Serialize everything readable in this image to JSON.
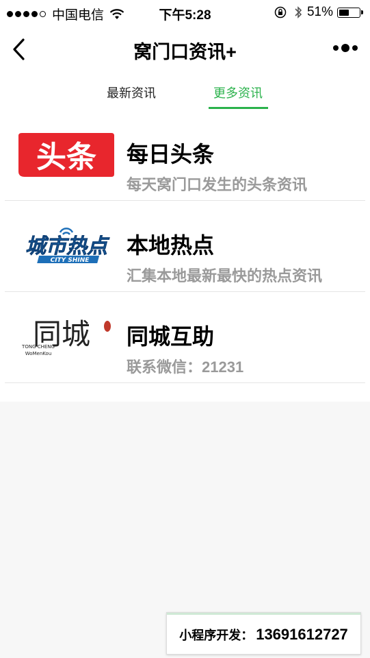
{
  "status_bar": {
    "carrier": "中国电信",
    "time": "下午5:28",
    "battery_pct": "51%",
    "battery_level": 0.51,
    "signal_dots_filled": 4
  },
  "nav": {
    "title": "窝门口资讯+"
  },
  "tabs": [
    {
      "label": "最新资讯",
      "active": false
    },
    {
      "label": "更多资讯",
      "active": true
    }
  ],
  "items": [
    {
      "title": "每日头条",
      "desc": "每天窝门口发生的头条资讯",
      "logo_text": "头条"
    },
    {
      "title": "本地热点",
      "desc": "汇集本地最新最快的热点资讯",
      "logo_text": "城市热点",
      "logo_subtext": "CITY SHINE"
    },
    {
      "title": "同城互助",
      "desc": "联系微信：21231",
      "logo_text": "同城",
      "logo_sub1": "TONG CHENG",
      "logo_sub2": "WoMenKou"
    }
  ],
  "promo": {
    "label": "小程序开发：",
    "phone": "13691612727"
  },
  "colors": {
    "accent": "#2bb24c",
    "toutiao_red": "#e8262d",
    "hotspot_blue": "#1d6fb8"
  }
}
